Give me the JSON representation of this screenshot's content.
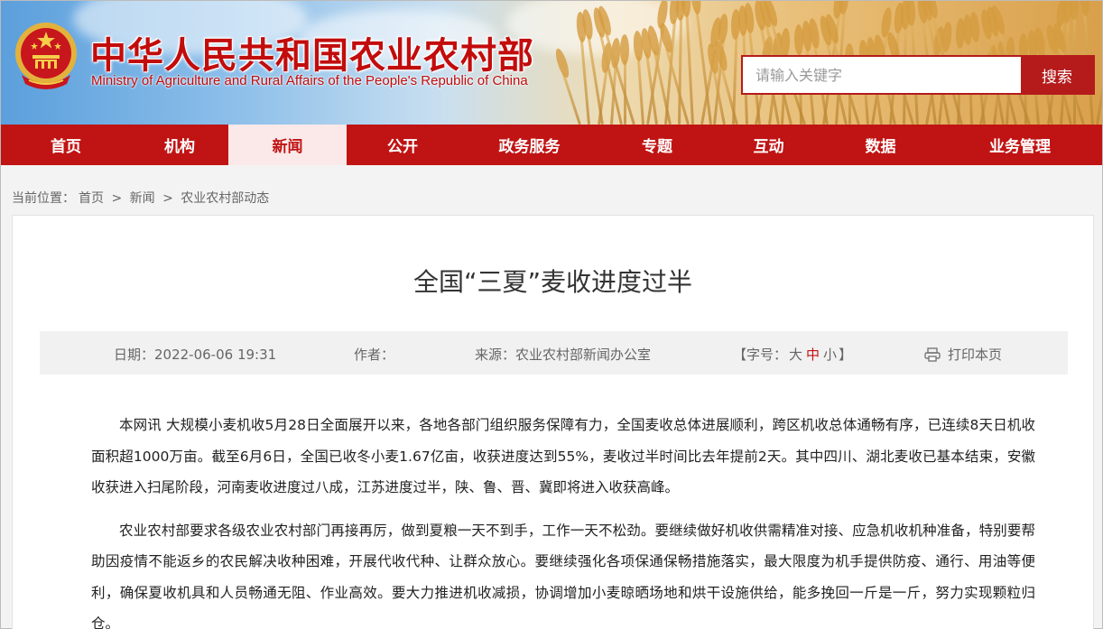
{
  "header": {
    "title_cn": "中华人民共和国农业农村部",
    "title_en": "Ministry of Agriculture and Rural Affairs of the People's Republic of China",
    "emblem_icon": "national-emblem-icon"
  },
  "search": {
    "placeholder": "请输入关键字",
    "button_label": "搜索"
  },
  "nav": {
    "items": [
      {
        "label": "首页"
      },
      {
        "label": "机构"
      },
      {
        "label": "新闻"
      },
      {
        "label": "公开"
      },
      {
        "label": "政务服务"
      },
      {
        "label": "专题"
      },
      {
        "label": "互动"
      },
      {
        "label": "数据"
      },
      {
        "label": "业务管理"
      }
    ],
    "active": "新闻"
  },
  "breadcrumb": {
    "prefix": "当前位置：",
    "items": [
      "首页",
      "新闻",
      "农业农村部动态"
    ],
    "separator": ">"
  },
  "article": {
    "title": "全国“三夏”麦收进度过半",
    "meta": {
      "date": "日期：2022-06-06 19:31",
      "author": "作者：",
      "source": "来源：农业农村部新闻办公室",
      "fontsize_open": "【字号：",
      "fontsize_large": "大",
      "fontsize_medium": "中",
      "fontsize_small": "小",
      "fontsize_close": "】",
      "print": "打印本页"
    },
    "paragraphs": [
      "本网讯 大规模小麦机收5月28日全面展开以来，各地各部门组织服务保障有力，全国麦收总体进展顺利，跨区机收总体通畅有序，已连续8天日机收面积超1000万亩。截至6月6日，全国已收冬小麦1.67亿亩，收获进度达到55%，麦收过半时间比去年提前2天。其中四川、湖北麦收已基本结束，安徽收获进入扫尾阶段，河南麦收进度过八成，江苏进度过半，陕、鲁、晋、冀即将进入收获高峰。",
      "农业农村部要求各级农业农村部门再接再厉，做到夏粮一天不到手，工作一天不松劲。要继续做好机收供需精准对接、应急机收机种准备，特别要帮助因疫情不能返乡的农民解决收种困难，开展代收代种、让群众放心。要继续强化各项保通保畅措施落实，最大限度为机手提供防疫、通行、用油等便利，确保夏收机具和人员畅通无阻、作业高效。要大力推进机收减损，协调增加小麦晾晒场地和烘干设施供给，能多挽回一斤是一斤，努力实现颗粒归仓。"
    ]
  },
  "colors": {
    "brand_red": "#c01414",
    "nav_active_bg": "#fbe9e9",
    "meta_bg": "#f1f1f1"
  }
}
